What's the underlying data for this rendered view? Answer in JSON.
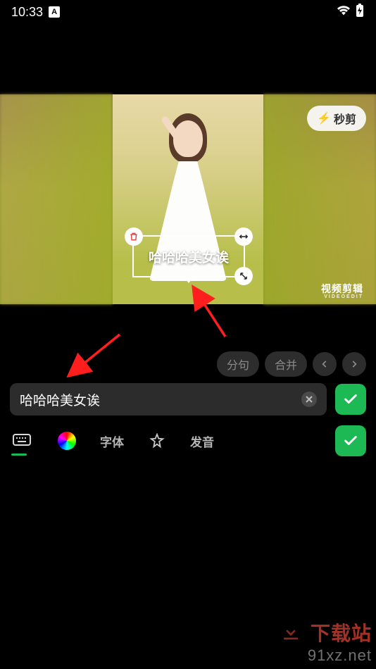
{
  "status": {
    "time": "10:33",
    "badge": "A"
  },
  "preview": {
    "quickcut_label": "秒剪",
    "watermark_cn": "视频剪辑",
    "watermark_en": "VIDEOEDIT",
    "overlay_text": "哈哈哈美女诶"
  },
  "chips": {
    "split": "分句",
    "merge": "合并"
  },
  "input": {
    "value": "哈哈哈美女诶",
    "placeholder": ""
  },
  "tools": {
    "font_label": "字体",
    "voice_label": "发音"
  },
  "site_watermark": {
    "line1": "下载站",
    "line2": "91xz.net"
  }
}
